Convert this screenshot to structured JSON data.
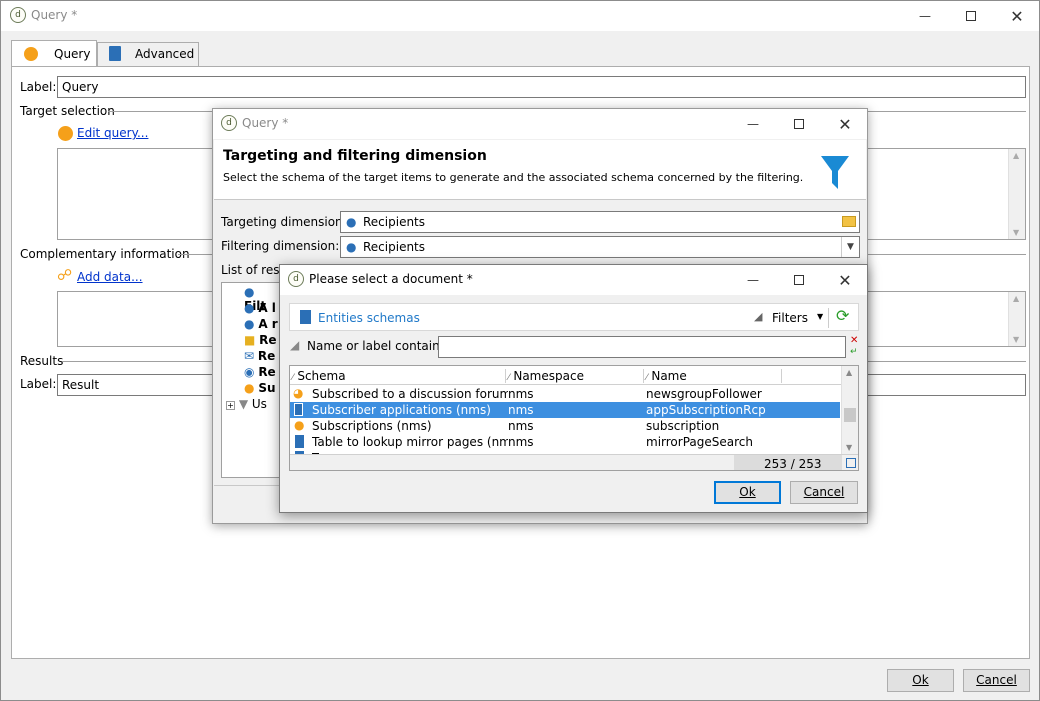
{
  "main_window": {
    "title": "Query *",
    "tabs": [
      {
        "label": "Query"
      },
      {
        "label": "Advanced"
      }
    ],
    "label_field": {
      "label": "Label:",
      "value": "Query"
    },
    "target_selection": {
      "heading": "Target selection",
      "edit_query": "Edit query..."
    },
    "complementary": {
      "heading": "Complementary information",
      "add_data": "Add data..."
    },
    "results": {
      "heading": "Results",
      "label": "Label:",
      "value": "Result"
    },
    "ok_label": "Ok",
    "cancel_label": "Cancel"
  },
  "query_dialog": {
    "title": "Query *",
    "heading": "Targeting and filtering dimension",
    "description": "Select the schema of the target items to  generate and the associated schema concerned by the filtering.",
    "targeting_label": "Targeting dimension:",
    "targeting_value": "Recipients",
    "filtering_label": "Filtering dimension:",
    "filtering_value": "Recipients",
    "list_label": "List of restr",
    "tree_items": [
      "Filt",
      "A l",
      "A r",
      "Re",
      "Re",
      "Re",
      "Su",
      "Us"
    ]
  },
  "select_dialog": {
    "title": "Please select a document *",
    "entities_label": "Entities schemas",
    "filters_label": "Filters",
    "search_label": "Name or label contains:",
    "search_value": "",
    "columns": [
      "Schema",
      "Namespace",
      "Name"
    ],
    "rows": [
      {
        "schema": "Subscribed to a discussion forum (n...",
        "namespace": "nms",
        "name": "newsgroupFollower",
        "icon": "rss-icon",
        "selected": false
      },
      {
        "schema": "Subscriber applications (nms)",
        "namespace": "nms",
        "name": "appSubscriptionRcp",
        "icon": "phone-icon",
        "selected": true
      },
      {
        "schema": "Subscriptions (nms)",
        "namespace": "nms",
        "name": "subscription",
        "icon": "person-icon",
        "selected": false
      },
      {
        "schema": "Table to lookup mirror pages (nms)",
        "namespace": "nms",
        "name": "mirrorPageSearch",
        "icon": "schema-icon",
        "selected": false
      },
      {
        "schema": "T",
        "namespace": "",
        "name": "",
        "icon": "schema-icon",
        "selected": false
      }
    ],
    "count": "253 / 253",
    "ok_label": "Ok",
    "cancel_label": "Cancel"
  },
  "colors": {
    "accent": "#0078d7",
    "selection": "#3d8fe0",
    "orange": "#f5a01a",
    "link": "#0033cc"
  }
}
